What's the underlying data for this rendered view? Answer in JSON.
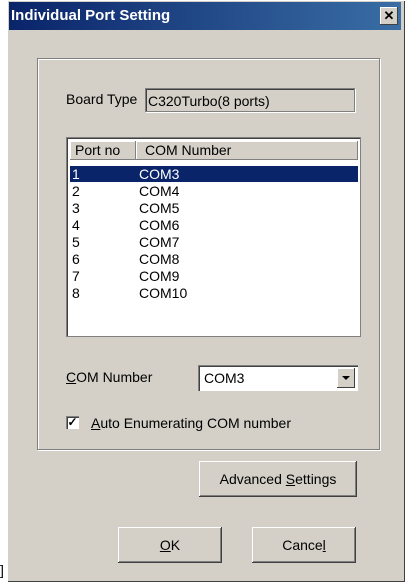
{
  "window": {
    "title": "Individual Port Setting",
    "close_glyph": "✕"
  },
  "board": {
    "label": "Board Type",
    "value": "C320Turbo(8 ports)"
  },
  "list": {
    "headers": [
      "Port no",
      "COM Number"
    ],
    "rows": [
      {
        "port": "1",
        "com": "COM3",
        "selected": true
      },
      {
        "port": "2",
        "com": "COM4"
      },
      {
        "port": "3",
        "com": "COM5"
      },
      {
        "port": "4",
        "com": "COM6"
      },
      {
        "port": "5",
        "com": "COM7"
      },
      {
        "port": "6",
        "com": "COM8"
      },
      {
        "port": "7",
        "com": "COM9"
      },
      {
        "port": "8",
        "com": "COM10"
      }
    ]
  },
  "com_number": {
    "label_mnemonic": "C",
    "label_rest": "OM Number",
    "value": "COM3"
  },
  "auto_enum": {
    "checked": true,
    "label_mnemonic": "A",
    "label_rest": "uto Enumerating COM number"
  },
  "buttons": {
    "advanced_pre": "Advanced ",
    "advanced_mnemonic": "S",
    "advanced_post": "ettings",
    "ok_mnemonic": "O",
    "ok_post": "K",
    "cancel_pre": "Cance",
    "cancel_mnemonic": "l"
  },
  "stray_text": "]"
}
